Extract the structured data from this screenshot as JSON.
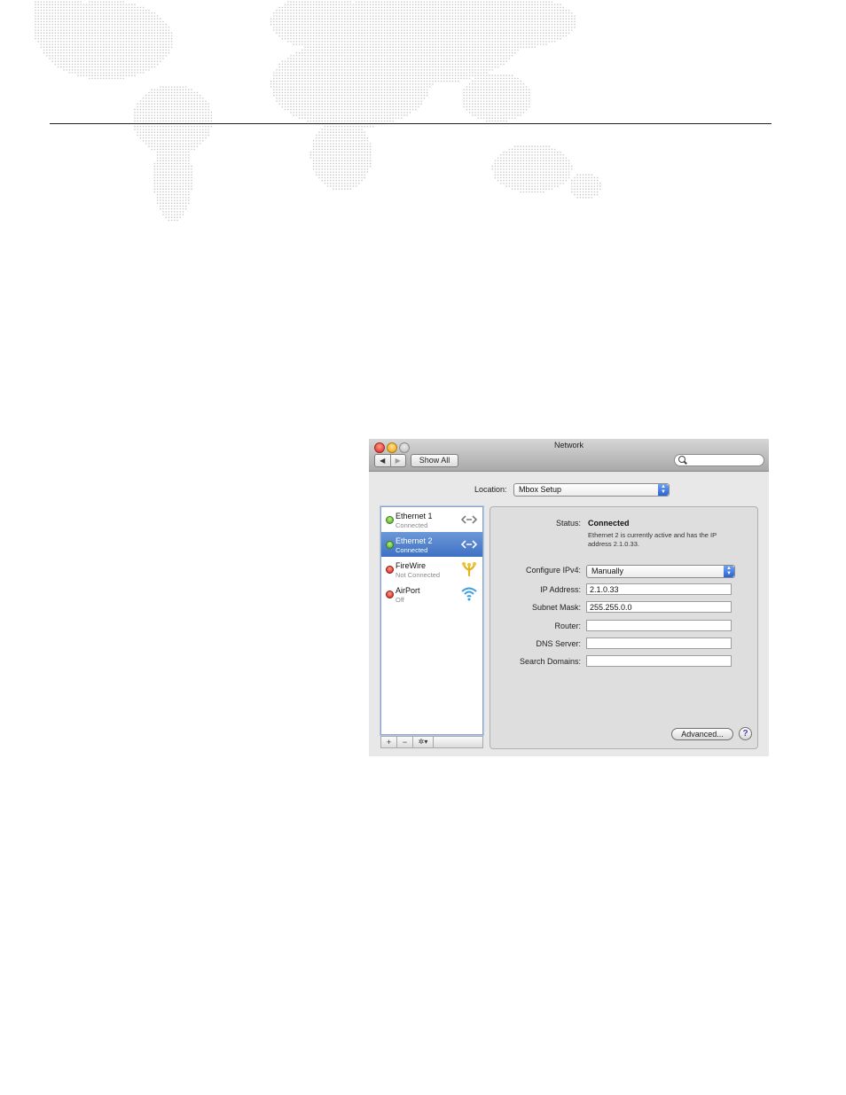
{
  "window": {
    "title": "Network",
    "nav_back": "◀",
    "nav_forward": "▶",
    "show_all": "Show All"
  },
  "location": {
    "label": "Location:",
    "value": "Mbox Setup"
  },
  "services": [
    {
      "name": "Ethernet 1",
      "status": "Connected",
      "indicator": "green",
      "icon": "ethernet-icon",
      "selected": false
    },
    {
      "name": "Ethernet 2",
      "status": "Connected",
      "indicator": "green",
      "icon": "ethernet-icon",
      "selected": true
    },
    {
      "name": "FireWire",
      "status": "Not Connected",
      "indicator": "red",
      "icon": "firewire-icon",
      "selected": false
    },
    {
      "name": "AirPort",
      "status": "Off",
      "indicator": "red",
      "icon": "airport-icon",
      "selected": false
    }
  ],
  "list_buttons": {
    "add": "+",
    "remove": "−",
    "action": "✲▾"
  },
  "detail": {
    "status_label": "Status:",
    "status_value": "Connected",
    "status_description": "Ethernet 2 is currently active and has the IP address 2.1.0.33.",
    "configure_label": "Configure IPv4:",
    "configure_value": "Manually",
    "ip_label": "IP Address:",
    "ip_value": "2.1.0.33",
    "subnet_label": "Subnet Mask:",
    "subnet_value": "255.255.0.0",
    "router_label": "Router:",
    "router_value": "",
    "dns_label": "DNS Server:",
    "dns_value": "",
    "search_domains_label": "Search Domains:",
    "search_domains_value": "",
    "advanced_button": "Advanced...",
    "help_button": "?"
  },
  "colors": {
    "selection": "#3e71c4",
    "connected": "#4aa51c",
    "disconnected": "#cf1f16",
    "map_dots": "#c8c8c8"
  }
}
